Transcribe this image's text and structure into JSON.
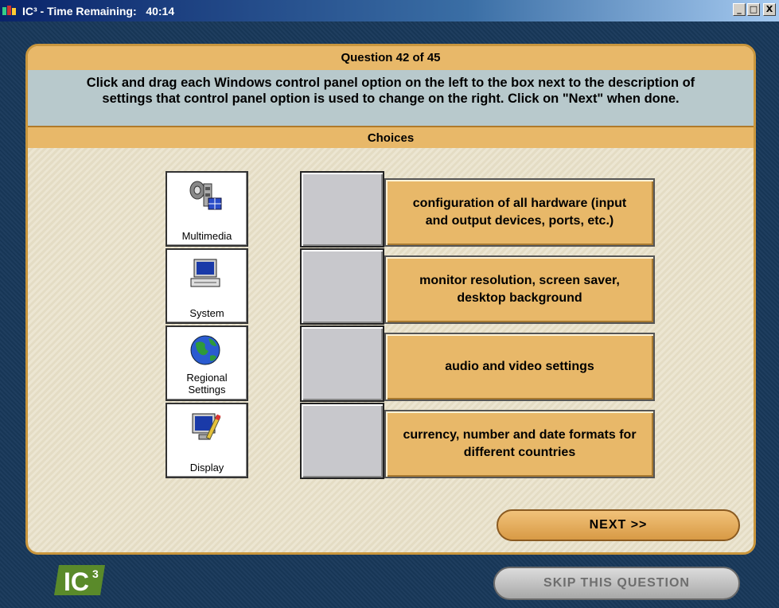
{
  "window": {
    "title": "IC³ - Time Remaining:   40:14",
    "buttons": [
      "_",
      "□",
      "X"
    ]
  },
  "question": {
    "header": "Question 42 of 45",
    "instructions": "Click and drag each Windows control panel option on the left to the box next to the description of settings that control panel option is used to change on the right. Click on \"Next\" when done.",
    "choices_label": "Choices"
  },
  "choices": [
    {
      "label": "Multimedia",
      "icon": "multimedia-icon"
    },
    {
      "label": "System",
      "icon": "computer-icon"
    },
    {
      "label": "Regional Settings",
      "icon": "globe-icon"
    },
    {
      "label": "Display",
      "icon": "display-icon"
    }
  ],
  "descriptions": [
    "configuration of all hardware (input and output devices, ports, etc.)",
    "monitor resolution, screen saver, desktop background",
    "audio and video settings",
    "currency, number and date formats for different countries"
  ],
  "buttons": {
    "next": "NEXT >>",
    "skip": "SKIP THIS QUESTION"
  },
  "logo_text": "IC³",
  "colors": {
    "accent": "#e8b869",
    "instructions_bg": "#b8c9cc",
    "panel_bg": "#e8e0c8",
    "page_bg": "#18385a"
  }
}
